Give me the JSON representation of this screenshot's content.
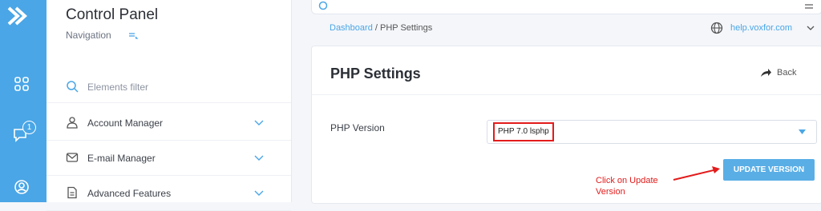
{
  "sidebar": {
    "title": "Control Panel",
    "nav_label": "Navigation",
    "filter_placeholder": "Elements filter",
    "items": [
      {
        "label": "Account Manager",
        "icon": "user-icon"
      },
      {
        "label": "E-mail Manager",
        "icon": "mail-icon"
      },
      {
        "label": "Advanced Features",
        "icon": "document-icon"
      }
    ]
  },
  "rail": {
    "color": "#4aa6e6",
    "icons": [
      "logo-icon",
      "grid-icon",
      "chat-icon",
      "user-circle-icon"
    ],
    "chat_badge": "1"
  },
  "breadcrumb": {
    "link": "Dashboard",
    "separator": " / ",
    "current": "PHP Settings"
  },
  "help": {
    "domain": "help.voxfor.com"
  },
  "page": {
    "title": "PHP Settings",
    "back_label": "Back",
    "php_version_label": "PHP Version",
    "php_version_value": "PHP 7.0 lsphp",
    "update_button": "UPDATE VERSION"
  },
  "annotation": {
    "line1": "Click on Update",
    "line2": "Version",
    "color": "#e31b1b"
  }
}
